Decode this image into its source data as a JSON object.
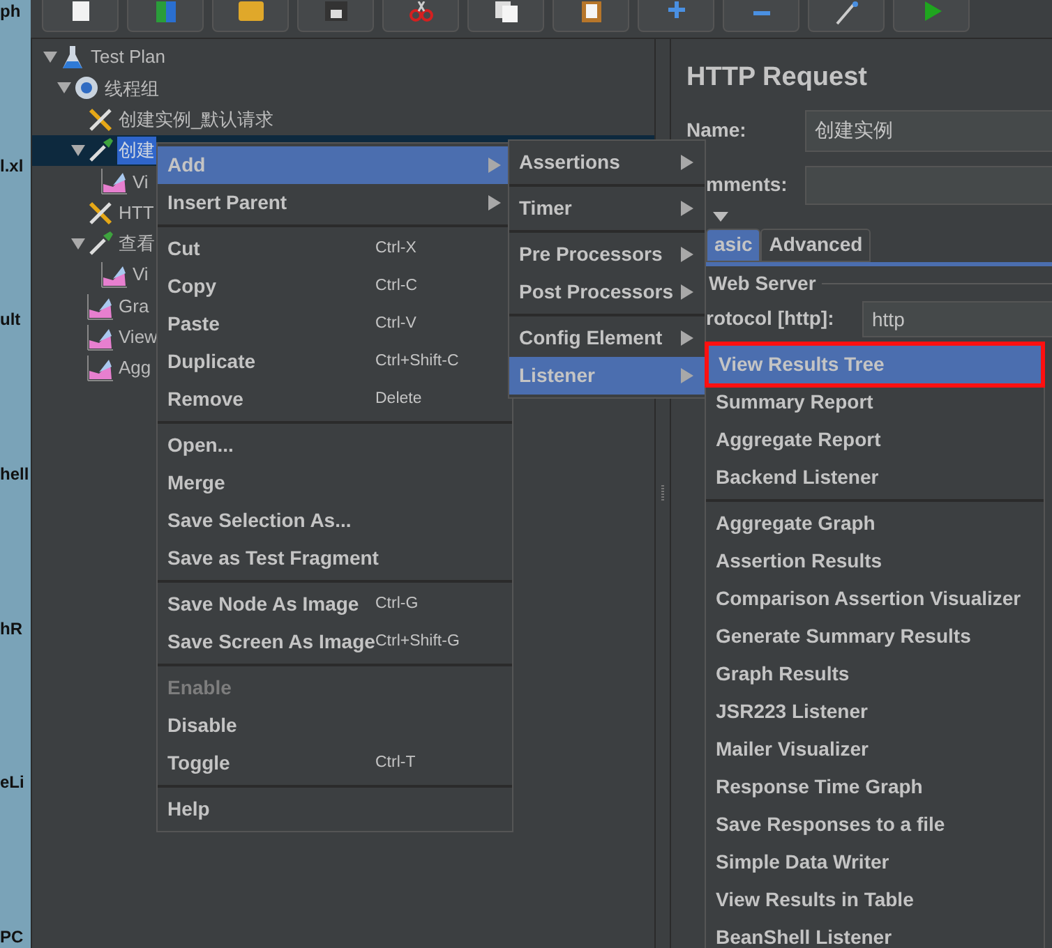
{
  "desktop_labels": [
    "ph",
    "l.xl",
    "ult",
    "hell",
    "hR",
    "eLi",
    "PC"
  ],
  "toolbar": [
    {
      "kind": "page"
    },
    {
      "kind": "cube"
    },
    {
      "kind": "folder"
    },
    {
      "kind": "disk"
    },
    {
      "kind": "scissors"
    },
    {
      "kind": "copy"
    },
    {
      "kind": "clipboard"
    },
    {
      "kind": "plus"
    },
    {
      "kind": "minus"
    },
    {
      "kind": "wand"
    },
    {
      "kind": "play"
    }
  ],
  "tree": [
    {
      "label": "Test Plan",
      "kind": "plan",
      "expanded": true,
      "selected": false,
      "children": [
        {
          "label": "线程组",
          "kind": "threads",
          "expanded": true,
          "selected": false,
          "children": [
            {
              "label": "创建实例_默认请求",
              "kind": "config",
              "selected": false
            },
            {
              "label": "创建",
              "kind": "sampler",
              "expanded": true,
              "selected": true,
              "children": [
                {
                  "label": "Vi",
                  "kind": "listener",
                  "selected": false
                }
              ]
            },
            {
              "label": "HTT",
              "kind": "config",
              "selected": false
            },
            {
              "label": "查看",
              "kind": "sampler",
              "expanded": true,
              "selected": false,
              "children": [
                {
                  "label": "Vi",
                  "kind": "listener",
                  "selected": false
                }
              ]
            },
            {
              "label": "Gra",
              "kind": "listener",
              "selected": false
            },
            {
              "label": "View",
              "kind": "listener",
              "selected": false
            },
            {
              "label": "Agg",
              "kind": "listener",
              "selected": false
            }
          ]
        }
      ]
    }
  ],
  "panel": {
    "title": "HTTP Request",
    "name_label": "Name:",
    "name_value": "创建实例",
    "comments_label": "mments:",
    "tabs": [
      {
        "label": "asic",
        "selected": true
      },
      {
        "label": "Advanced",
        "selected": false
      }
    ],
    "section": "Web Server",
    "protocol_label": "rotocol [http]:",
    "protocol_value": "http"
  },
  "context_menu": {
    "groups": [
      [
        {
          "label": "Add",
          "submenu": true,
          "selected": true,
          "disabled": false
        },
        {
          "label": "Insert Parent",
          "submenu": true,
          "selected": false,
          "disabled": false
        }
      ],
      [
        {
          "label": "Cut",
          "shortcut": "Ctrl-X",
          "selected": false,
          "disabled": false
        },
        {
          "label": "Copy",
          "shortcut": "Ctrl-C",
          "selected": false,
          "disabled": false
        },
        {
          "label": "Paste",
          "shortcut": "Ctrl-V",
          "selected": false,
          "disabled": false
        },
        {
          "label": "Duplicate",
          "shortcut": "Ctrl+Shift-C",
          "selected": false,
          "disabled": false
        },
        {
          "label": "Remove",
          "shortcut": "Delete",
          "selected": false,
          "disabled": false
        }
      ],
      [
        {
          "label": "Open...",
          "selected": false,
          "disabled": false
        },
        {
          "label": "Merge",
          "selected": false,
          "disabled": false
        },
        {
          "label": "Save Selection As...",
          "selected": false,
          "disabled": false
        },
        {
          "label": "Save as Test Fragment",
          "selected": false,
          "disabled": false
        }
      ],
      [
        {
          "label": "Save Node As Image",
          "shortcut": "Ctrl-G",
          "selected": false,
          "disabled": false
        },
        {
          "label": "Save Screen As Image",
          "shortcut": "Ctrl+Shift-G",
          "selected": false,
          "disabled": false
        }
      ],
      [
        {
          "label": "Enable",
          "selected": false,
          "disabled": true
        },
        {
          "label": "Disable",
          "selected": false,
          "disabled": false
        },
        {
          "label": "Toggle",
          "shortcut": "Ctrl-T",
          "selected": false,
          "disabled": false
        }
      ],
      [
        {
          "label": "Help",
          "selected": false,
          "disabled": false
        }
      ]
    ]
  },
  "add_submenu": {
    "groups": [
      [
        {
          "label": "Assertions",
          "submenu": true,
          "selected": false
        }
      ],
      [
        {
          "label": "Timer",
          "submenu": true,
          "selected": false
        }
      ],
      [
        {
          "label": "Pre Processors",
          "submenu": true,
          "selected": false
        },
        {
          "label": "Post Processors",
          "submenu": true,
          "selected": false
        }
      ],
      [
        {
          "label": "Config Element",
          "submenu": true,
          "selected": false
        },
        {
          "label": "Listener",
          "submenu": true,
          "selected": true
        }
      ]
    ]
  },
  "listener_submenu": {
    "groups": [
      [
        {
          "label": "View Results Tree",
          "selected": true,
          "highlighted": true
        },
        {
          "label": "Summary Report",
          "selected": false,
          "highlighted": false
        },
        {
          "label": "Aggregate Report",
          "selected": false,
          "highlighted": false
        },
        {
          "label": "Backend Listener",
          "selected": false,
          "highlighted": false
        }
      ],
      [
        {
          "label": "Aggregate Graph",
          "selected": false,
          "highlighted": false
        },
        {
          "label": "Assertion Results",
          "selected": false,
          "highlighted": false
        },
        {
          "label": "Comparison Assertion Visualizer",
          "selected": false,
          "highlighted": false
        },
        {
          "label": "Generate Summary Results",
          "selected": false,
          "highlighted": false
        },
        {
          "label": "Graph Results",
          "selected": false,
          "highlighted": false
        },
        {
          "label": "JSR223 Listener",
          "selected": false,
          "highlighted": false
        },
        {
          "label": "Mailer Visualizer",
          "selected": false,
          "highlighted": false
        },
        {
          "label": "Response Time Graph",
          "selected": false,
          "highlighted": false
        },
        {
          "label": "Save Responses to a file",
          "selected": false,
          "highlighted": false
        },
        {
          "label": "Simple Data Writer",
          "selected": false,
          "highlighted": false
        },
        {
          "label": "View Results in Table",
          "selected": false,
          "highlighted": false
        },
        {
          "label": "BeanShell Listener",
          "selected": false,
          "highlighted": false
        }
      ]
    ]
  }
}
